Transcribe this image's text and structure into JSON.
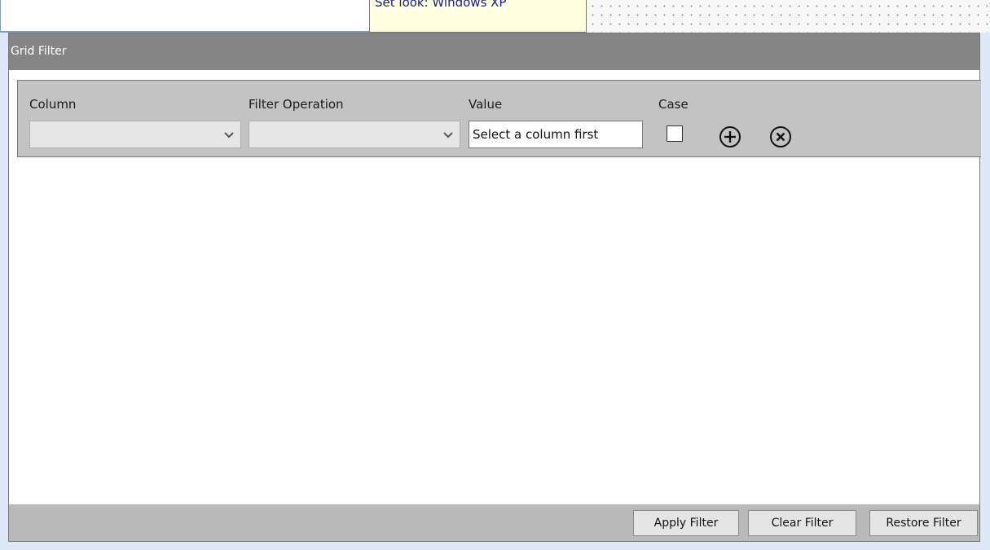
{
  "tooltip": {
    "text": "Set look: Windows XP"
  },
  "panel": {
    "title": "Grid Filter"
  },
  "filter_row": {
    "column_label": "Column",
    "operation_label": "Filter Operation",
    "value_label": "Value",
    "case_label": "Case",
    "column_value": "",
    "operation_value": "",
    "value_text": "Select a column first",
    "case_checked": false,
    "icons": {
      "add": "plus-circle-icon",
      "remove": "x-circle-icon",
      "dropdown": "chevron-down-icon"
    }
  },
  "buttons": {
    "apply": "Apply Filter",
    "clear": "Clear Filter",
    "restore": "Restore Filter"
  }
}
